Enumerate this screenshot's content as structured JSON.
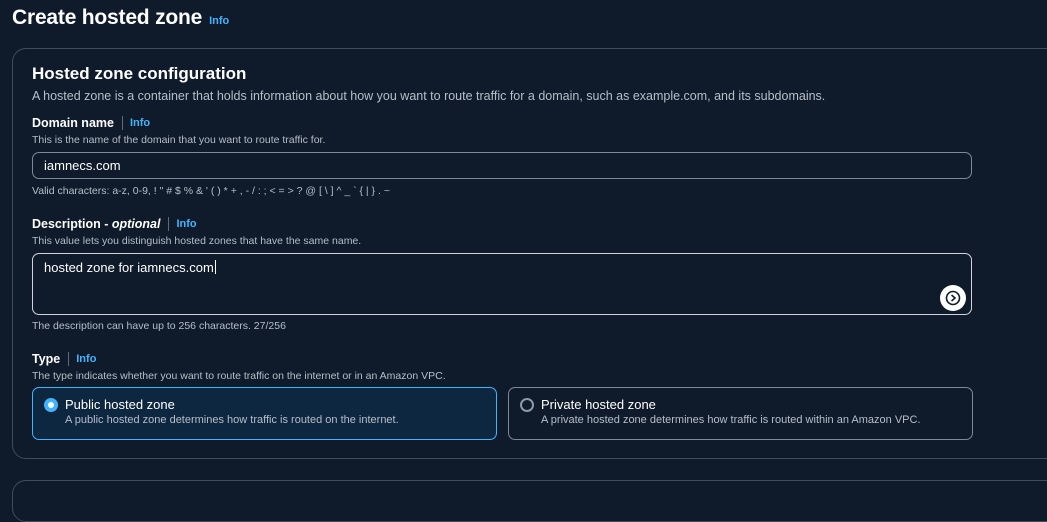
{
  "header": {
    "title": "Create hosted zone",
    "info": "Info"
  },
  "config": {
    "title": "Hosted zone configuration",
    "description": "A hosted zone is a container that holds information about how you want to route traffic for a domain, such as example.com, and its subdomains.",
    "domain": {
      "label": "Domain name",
      "info": "Info",
      "hint": "This is the name of the domain that you want to route traffic for.",
      "value": "iamnecs.com",
      "constraint": "Valid characters: a-z, 0-9, ! \" # $ % & ' ( ) * + , - / : ; < = > ? @ [ \\ ] ^ _ ` { | } . ~"
    },
    "description_field": {
      "label": "Description - ",
      "optional": "optional",
      "info": "Info",
      "hint": "This value lets you distinguish hosted zones that have the same name.",
      "value": "hosted zone for iamnecs.com",
      "constraint": "The description can have up to 256 characters. 27/256"
    },
    "type": {
      "label": "Type",
      "info": "Info",
      "hint": "The type indicates whether you want to route traffic on the internet or in an Amazon VPC.",
      "options": [
        {
          "title": "Public hosted zone",
          "desc": "A public hosted zone determines how traffic is routed on the internet.",
          "selected": true
        },
        {
          "title": "Private hosted zone",
          "desc": "A private hosted zone determines how traffic is routed within an Amazon VPC.",
          "selected": false
        }
      ]
    }
  },
  "colors": {
    "background": "#0f1b2a",
    "accent": "#42b4ff",
    "border": "#414d5c"
  },
  "icons": {
    "assist": "assistant-icon"
  }
}
